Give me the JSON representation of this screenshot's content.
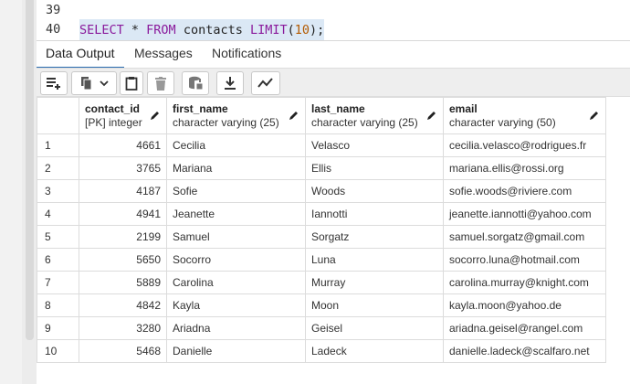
{
  "editor": {
    "lines": [
      {
        "number": "39",
        "code": ""
      },
      {
        "number": "40",
        "tokens": {
          "select": "SELECT",
          "star": " * ",
          "from": "FROM",
          "table": " contacts ",
          "limit": "LIMIT",
          "open": "(",
          "value": "10",
          "close": ");"
        }
      }
    ]
  },
  "tabs": [
    {
      "label": "Data Output",
      "active": true
    },
    {
      "label": "Messages",
      "active": false
    },
    {
      "label": "Notifications",
      "active": false
    }
  ],
  "toolbar": {
    "icons": [
      "add-row-icon",
      "copy-icon",
      "dropdown-chevron-icon",
      "paste-icon",
      "delete-icon",
      "save-data-icon",
      "download-icon",
      "graph-icon"
    ]
  },
  "grid": {
    "columns": [
      {
        "name": "contact_id",
        "type": "[PK] integer"
      },
      {
        "name": "first_name",
        "type": "character varying (25)"
      },
      {
        "name": "last_name",
        "type": "character varying (25)"
      },
      {
        "name": "email",
        "type": "character varying (50)"
      }
    ],
    "rows": [
      {
        "n": "1",
        "id": "4661",
        "first": "Cecilia",
        "last": "Velasco",
        "email": "cecilia.velasco@rodrigues.fr"
      },
      {
        "n": "2",
        "id": "3765",
        "first": "Mariana",
        "last": "Ellis",
        "email": "mariana.ellis@rossi.org"
      },
      {
        "n": "3",
        "id": "4187",
        "first": "Sofie",
        "last": "Woods",
        "email": "sofie.woods@riviere.com"
      },
      {
        "n": "4",
        "id": "4941",
        "first": "Jeanette",
        "last": "Iannotti",
        "email": "jeanette.iannotti@yahoo.com"
      },
      {
        "n": "5",
        "id": "2199",
        "first": "Samuel",
        "last": "Sorgatz",
        "email": "samuel.sorgatz@gmail.com"
      },
      {
        "n": "6",
        "id": "5650",
        "first": "Socorro",
        "last": "Luna",
        "email": "socorro.luna@hotmail.com"
      },
      {
        "n": "7",
        "id": "5889",
        "first": "Carolina",
        "last": "Murray",
        "email": "carolina.murray@knight.com"
      },
      {
        "n": "8",
        "id": "4842",
        "first": "Kayla",
        "last": "Moon",
        "email": "kayla.moon@yahoo.de"
      },
      {
        "n": "9",
        "id": "3280",
        "first": "Ariadna",
        "last": "Geisel",
        "email": "ariadna.geisel@rangel.com"
      },
      {
        "n": "10",
        "id": "5468",
        "first": "Danielle",
        "last": "Ladeck",
        "email": "danielle.ladeck@scalfaro.net"
      }
    ]
  }
}
